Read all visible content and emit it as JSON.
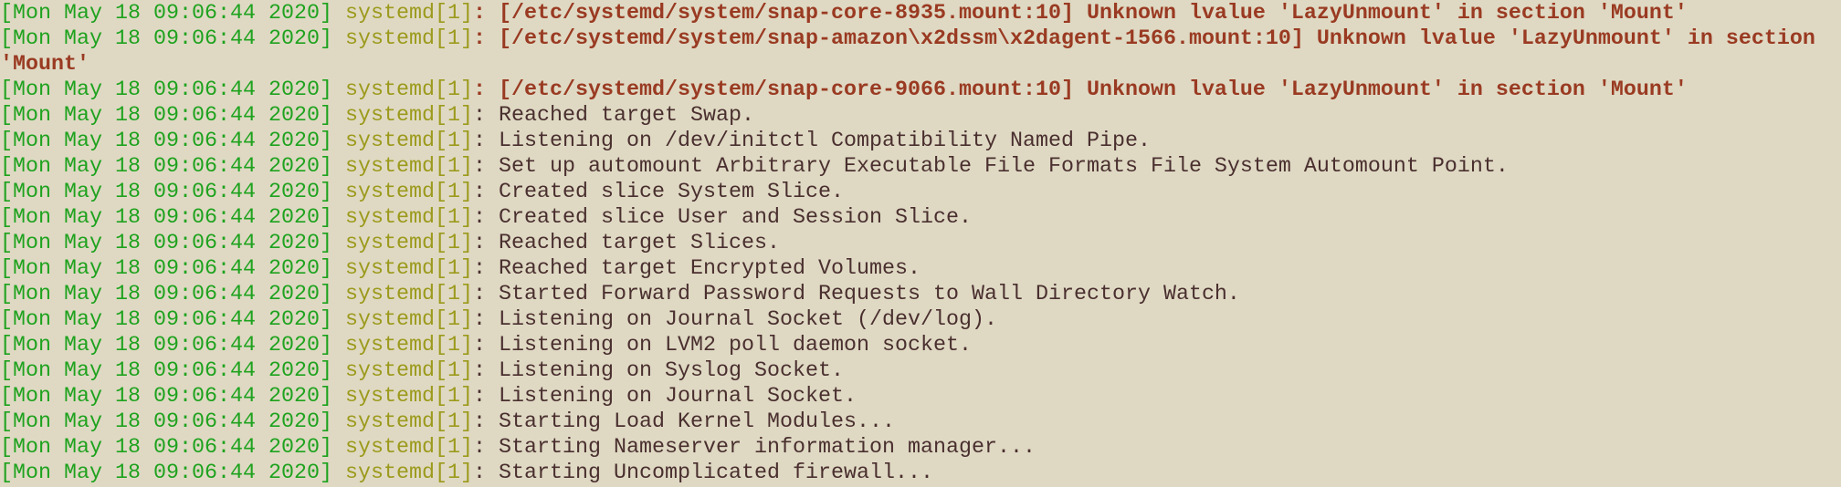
{
  "colors": {
    "background": "#dfd9c3",
    "timestamp": "#1ea21e",
    "process": "#9c9a1c",
    "error": "#9a3a22",
    "text": "#4a2f2f"
  },
  "lines": [
    {
      "ts": "[Mon May 18 09:06:44 2020]",
      "proc": "systemd[1]",
      "msg": "[/etc/systemd/system/snap-core-8935.mount:10] Unknown lvalue 'LazyUnmount' in section 'Mount'",
      "error": true
    },
    {
      "ts": "[Mon May 18 09:06:44 2020]",
      "proc": "systemd[1]",
      "msg": "[/etc/systemd/system/snap-amazon\\x2dssm\\x2dagent-1566.mount:10] Unknown lvalue 'LazyUnmount' in section 'Mount'",
      "error": true
    },
    {
      "ts": "[Mon May 18 09:06:44 2020]",
      "proc": "systemd[1]",
      "msg": "[/etc/systemd/system/snap-core-9066.mount:10] Unknown lvalue 'LazyUnmount' in section 'Mount'",
      "error": true
    },
    {
      "ts": "[Mon May 18 09:06:44 2020]",
      "proc": "systemd[1]",
      "msg": "Reached target Swap.",
      "error": false
    },
    {
      "ts": "[Mon May 18 09:06:44 2020]",
      "proc": "systemd[1]",
      "msg": "Listening on /dev/initctl Compatibility Named Pipe.",
      "error": false
    },
    {
      "ts": "[Mon May 18 09:06:44 2020]",
      "proc": "systemd[1]",
      "msg": "Set up automount Arbitrary Executable File Formats File System Automount Point.",
      "error": false
    },
    {
      "ts": "[Mon May 18 09:06:44 2020]",
      "proc": "systemd[1]",
      "msg": "Created slice System Slice.",
      "error": false
    },
    {
      "ts": "[Mon May 18 09:06:44 2020]",
      "proc": "systemd[1]",
      "msg": "Created slice User and Session Slice.",
      "error": false
    },
    {
      "ts": "[Mon May 18 09:06:44 2020]",
      "proc": "systemd[1]",
      "msg": "Reached target Slices.",
      "error": false
    },
    {
      "ts": "[Mon May 18 09:06:44 2020]",
      "proc": "systemd[1]",
      "msg": "Reached target Encrypted Volumes.",
      "error": false
    },
    {
      "ts": "[Mon May 18 09:06:44 2020]",
      "proc": "systemd[1]",
      "msg": "Started Forward Password Requests to Wall Directory Watch.",
      "error": false
    },
    {
      "ts": "[Mon May 18 09:06:44 2020]",
      "proc": "systemd[1]",
      "msg": "Listening on Journal Socket (/dev/log).",
      "error": false
    },
    {
      "ts": "[Mon May 18 09:06:44 2020]",
      "proc": "systemd[1]",
      "msg": "Listening on LVM2 poll daemon socket.",
      "error": false
    },
    {
      "ts": "[Mon May 18 09:06:44 2020]",
      "proc": "systemd[1]",
      "msg": "Listening on Syslog Socket.",
      "error": false
    },
    {
      "ts": "[Mon May 18 09:06:44 2020]",
      "proc": "systemd[1]",
      "msg": "Listening on Journal Socket.",
      "error": false
    },
    {
      "ts": "[Mon May 18 09:06:44 2020]",
      "proc": "systemd[1]",
      "msg": "Starting Load Kernel Modules...",
      "error": false
    },
    {
      "ts": "[Mon May 18 09:06:44 2020]",
      "proc": "systemd[1]",
      "msg": "Starting Nameserver information manager...",
      "error": false
    },
    {
      "ts": "[Mon May 18 09:06:44 2020]",
      "proc": "systemd[1]",
      "msg": "Starting Uncomplicated firewall...",
      "error": false
    }
  ]
}
